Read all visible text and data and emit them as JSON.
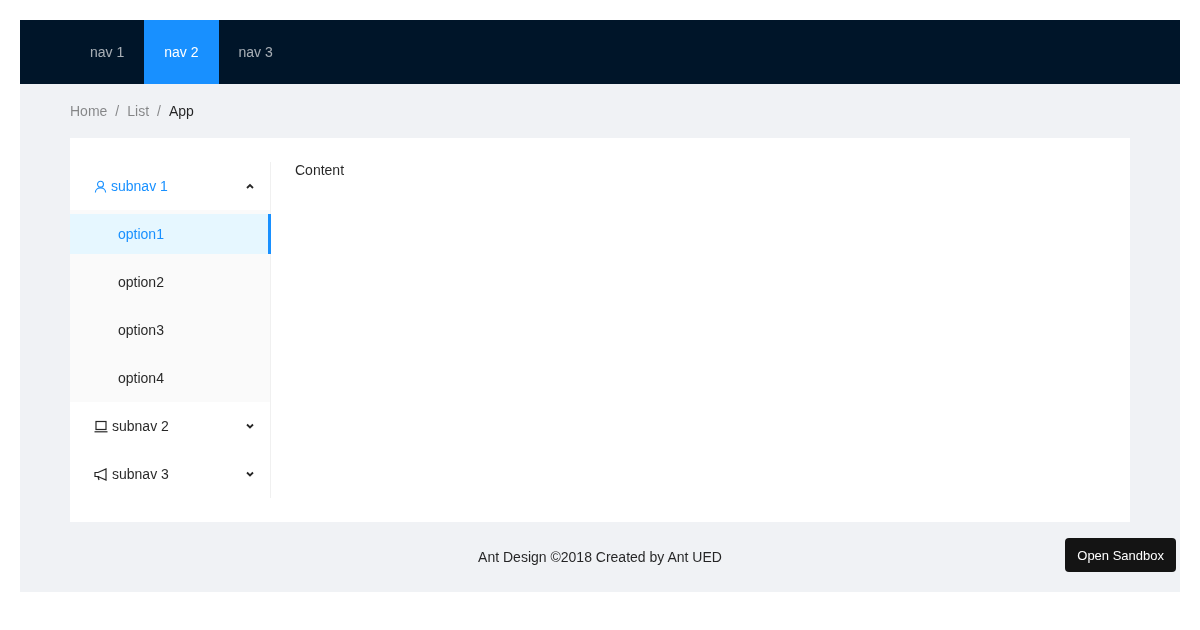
{
  "header": {
    "nav": [
      {
        "label": "nav 1",
        "selected": false
      },
      {
        "label": "nav 2",
        "selected": true
      },
      {
        "label": "nav 3",
        "selected": false
      }
    ]
  },
  "breadcrumb": {
    "items": [
      "Home",
      "List",
      "App"
    ],
    "separators": [
      "/",
      "/"
    ]
  },
  "sidebar": {
    "submenus": [
      {
        "label": "subnav 1",
        "kind": "user",
        "expanded": true,
        "items": [
          {
            "label": "option1",
            "selected": true
          },
          {
            "label": "option2",
            "selected": false
          },
          {
            "label": "option3",
            "selected": false
          },
          {
            "label": "option4",
            "selected": false
          }
        ]
      },
      {
        "label": "subnav 2",
        "kind": "laptop",
        "expanded": false
      },
      {
        "label": "subnav 3",
        "kind": "notification",
        "expanded": false
      }
    ]
  },
  "content": "Content",
  "footer": "Ant Design ©2018 Created by Ant UED",
  "sandbox_button": "Open Sandbox"
}
